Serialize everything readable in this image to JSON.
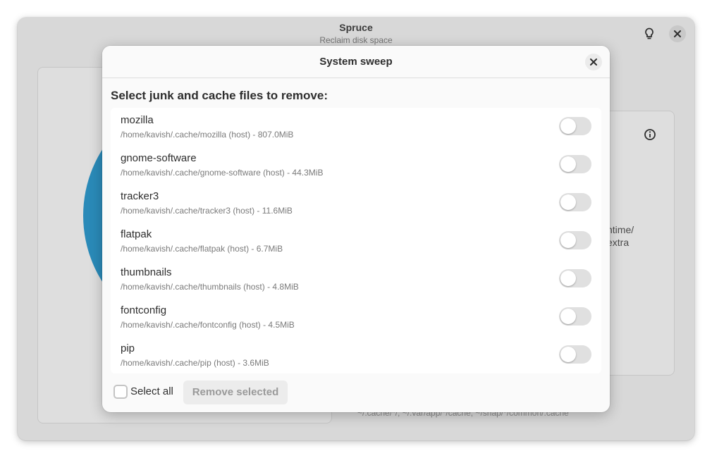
{
  "window": {
    "title": "Spruce",
    "subtitle": "Reclaim disk space"
  },
  "background": {
    "path_line_1": "ntime/",
    "path_line_2": "extra",
    "footer_text": "~/.cache/*/, ~/.var/app/*/cache, ~/snap/*/common/.cache"
  },
  "dialog": {
    "title": "System sweep",
    "heading": "Select junk and cache files to remove:",
    "items": [
      {
        "name": "mozilla",
        "detail": "/home/kavish/.cache/mozilla (host) - 807.0MiB",
        "enabled": false
      },
      {
        "name": "gnome-software",
        "detail": "/home/kavish/.cache/gnome-software (host) - 44.3MiB",
        "enabled": false
      },
      {
        "name": "tracker3",
        "detail": "/home/kavish/.cache/tracker3 (host) - 11.6MiB",
        "enabled": false
      },
      {
        "name": "flatpak",
        "detail": "/home/kavish/.cache/flatpak (host) - 6.7MiB",
        "enabled": false
      },
      {
        "name": "thumbnails",
        "detail": "/home/kavish/.cache/thumbnails (host) - 4.8MiB",
        "enabled": false
      },
      {
        "name": "fontconfig",
        "detail": "/home/kavish/.cache/fontconfig (host) - 4.5MiB",
        "enabled": false
      },
      {
        "name": "pip",
        "detail": "/home/kavish/.cache/pip (host) - 3.6MiB",
        "enabled": false
      }
    ],
    "select_all_label": "Select all",
    "remove_label": "Remove selected"
  },
  "colors": {
    "pie_blue": "#2a8ab8",
    "pie_green": "#4fa574"
  },
  "icons": {
    "hint": "lightbulb-icon",
    "close": "close-icon",
    "info": "info-icon"
  }
}
